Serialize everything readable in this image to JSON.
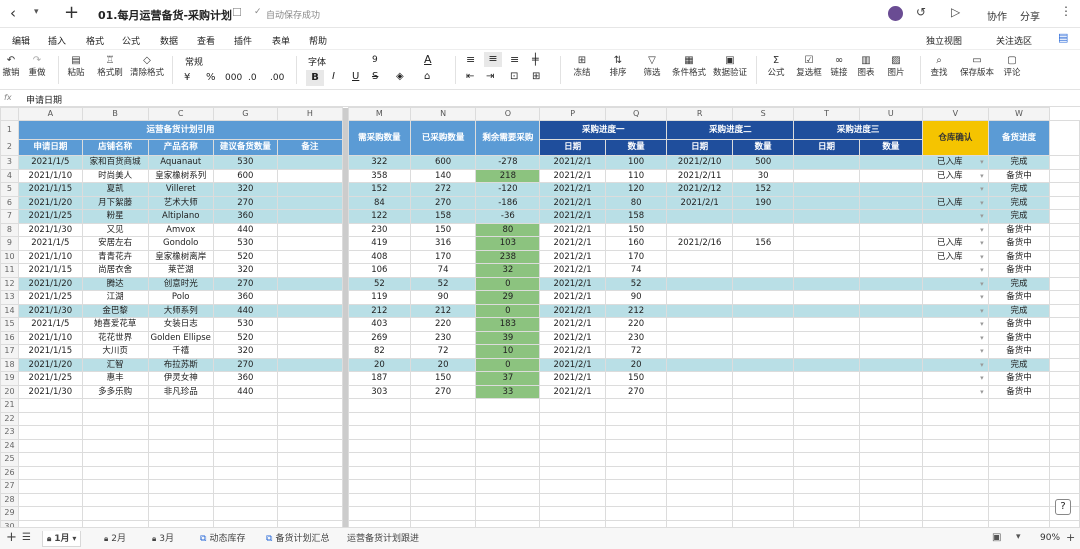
{
  "title": {
    "back": "‹",
    "dropdown": "▾",
    "new": "+",
    "doc_title": "01.每月运营备货-采购计划",
    "save_status": "自动保存成功",
    "collab": "协作",
    "share": "分享"
  },
  "menu": [
    "编辑",
    "插入",
    "格式",
    "公式",
    "数据",
    "查看",
    "插件",
    "表单",
    "帮助"
  ],
  "menu_right": {
    "view_mode": "独立视图",
    "focus": "关注选区"
  },
  "toolbar": {
    "undo": "撤销",
    "redo": "重做",
    "paste": "粘贴",
    "format_painter": "格式刷",
    "clear_format": "清除格式",
    "number_format": "常规",
    "font": "字体",
    "font_size": "9",
    "freeze": "冻结",
    "sort": "排序",
    "filter": "筛选",
    "cond_format": "条件格式",
    "validation": "数据验证",
    "formula": "公式",
    "checkbox": "复选框",
    "link": "链接",
    "chart": "图表",
    "image": "图片",
    "find": "查找",
    "save_version": "保存版本",
    "comment": "评论",
    "percent": "%",
    "thousand": "000",
    "dec_inc": ".0",
    "dec_dec": ".00"
  },
  "formula_bar": {
    "fx": "fx",
    "value": "申请日期"
  },
  "sheet": {
    "col_letters": [
      "A",
      "B",
      "C",
      "G",
      "H",
      "M",
      "N",
      "O",
      "P",
      "Q",
      "R",
      "S",
      "T",
      "U",
      "V",
      "W"
    ],
    "header1": {
      "plan": "运营备货计划引用",
      "need": "需采购数量",
      "bought": "已采购数量",
      "remain": "剩余需要采购",
      "p1": "采购进度一",
      "p2": "采购进度二",
      "p3": "采购进度三",
      "warehouse": "仓库确认",
      "progress": "备货进度"
    },
    "header2": [
      "申请日期",
      "店铺名称",
      "产品名称",
      "建议备货数量",
      "备注",
      "日期",
      "数量",
      "日期",
      "数量",
      "日期",
      "数量"
    ],
    "rows": [
      [
        "2021/1/5",
        "家和百货商城",
        "Aquanaut",
        "530",
        "",
        "322",
        "600",
        "-278",
        "2021/2/1",
        "100",
        "2021/2/10",
        "500",
        "",
        "",
        "已入库",
        "完成"
      ],
      [
        "2021/1/10",
        "时尚美人",
        "皇家橡树系列",
        "600",
        "",
        "358",
        "140",
        "218",
        "2021/2/1",
        "110",
        "2021/2/11",
        "30",
        "",
        "",
        "已入库",
        "备货中"
      ],
      [
        "2021/1/15",
        "夏凯",
        "Villeret",
        "320",
        "",
        "152",
        "272",
        "-120",
        "2021/2/1",
        "120",
        "2021/2/12",
        "152",
        "",
        "",
        "",
        "完成"
      ],
      [
        "2021/1/20",
        "月下絮藤",
        "艺术大师",
        "270",
        "",
        "84",
        "270",
        "-186",
        "2021/2/1",
        "80",
        "2021/2/1",
        "190",
        "",
        "",
        "已入库",
        "完成"
      ],
      [
        "2021/1/25",
        "粉星",
        "Altiplano",
        "360",
        "",
        "122",
        "158",
        "-36",
        "2021/2/1",
        "158",
        "",
        "",
        "",
        "",
        "",
        "完成"
      ],
      [
        "2021/1/30",
        "又见",
        "Amvox",
        "440",
        "",
        "230",
        "150",
        "80",
        "2021/2/1",
        "150",
        "",
        "",
        "",
        "",
        "",
        "备货中"
      ],
      [
        "2021/1/5",
        "安居左右",
        "Gondolo",
        "530",
        "",
        "419",
        "316",
        "103",
        "2021/2/1",
        "160",
        "2021/2/16",
        "156",
        "",
        "",
        "已入库",
        "备货中"
      ],
      [
        "2021/1/10",
        "青青花卉",
        "皇家橡树离岸",
        "520",
        "",
        "408",
        "170",
        "238",
        "2021/2/1",
        "170",
        "",
        "",
        "",
        "",
        "已入库",
        "备货中"
      ],
      [
        "2021/1/15",
        "尚居衣舍",
        "莱芒湖",
        "320",
        "",
        "106",
        "74",
        "32",
        "2021/2/1",
        "74",
        "",
        "",
        "",
        "",
        "",
        "备货中"
      ],
      [
        "2021/1/20",
        "腾达",
        "创意时光",
        "270",
        "",
        "52",
        "52",
        "0",
        "2021/2/1",
        "52",
        "",
        "",
        "",
        "",
        "",
        "完成"
      ],
      [
        "2021/1/25",
        "江湖",
        "Polo",
        "360",
        "",
        "119",
        "90",
        "29",
        "2021/2/1",
        "90",
        "",
        "",
        "",
        "",
        "",
        "备货中"
      ],
      [
        "2021/1/30",
        "金巴黎",
        "大师系列",
        "440",
        "",
        "212",
        "212",
        "0",
        "2021/2/1",
        "212",
        "",
        "",
        "",
        "",
        "",
        "完成"
      ],
      [
        "2021/1/5",
        "她喜爱花草",
        "女装日志",
        "530",
        "",
        "403",
        "220",
        "183",
        "2021/2/1",
        "220",
        "",
        "",
        "",
        "",
        "",
        "备货中"
      ],
      [
        "2021/1/10",
        "花花世界",
        "Golden Ellipse",
        "520",
        "",
        "269",
        "230",
        "39",
        "2021/2/1",
        "230",
        "",
        "",
        "",
        "",
        "",
        "备货中"
      ],
      [
        "2021/1/15",
        "大川页",
        "千禧",
        "320",
        "",
        "82",
        "72",
        "10",
        "2021/2/1",
        "72",
        "",
        "",
        "",
        "",
        "",
        "备货中"
      ],
      [
        "2021/1/20",
        "汇智",
        "布拉苏斯",
        "270",
        "",
        "20",
        "20",
        "0",
        "2021/2/1",
        "20",
        "",
        "",
        "",
        "",
        "",
        "完成"
      ],
      [
        "2021/1/25",
        "惠丰",
        "伊灵女神",
        "360",
        "",
        "187",
        "150",
        "37",
        "2021/2/1",
        "150",
        "",
        "",
        "",
        "",
        "",
        "备货中"
      ],
      [
        "2021/1/30",
        "多多乐购",
        "非凡珍品",
        "440",
        "",
        "303",
        "270",
        "33",
        "2021/2/1",
        "270",
        "",
        "",
        "",
        "",
        "",
        "备货中"
      ]
    ],
    "teal_rows": [
      0,
      2,
      3,
      4,
      9,
      11,
      15
    ],
    "green_rows": [
      1,
      5,
      6,
      7,
      8,
      9,
      10,
      11,
      12,
      13,
      14,
      15,
      16,
      17
    ],
    "empty_rows": 10
  },
  "tabs": [
    {
      "label": "1月",
      "lock": true,
      "active": true
    },
    {
      "label": "2月",
      "lock": true
    },
    {
      "label": "3月",
      "lock": true
    },
    {
      "label": "动态库存",
      "link": true
    },
    {
      "label": "备货计划汇总",
      "link": true
    },
    {
      "label": "运营备货计划跟进"
    }
  ],
  "zoom": "90%",
  "colors": {
    "blue_header": "#5b9bd5",
    "navy_header": "#1f4e9c",
    "yellow_header": "#f5c400",
    "teal_row": "#b9dfe6",
    "green_cell": "#8cc37f"
  }
}
